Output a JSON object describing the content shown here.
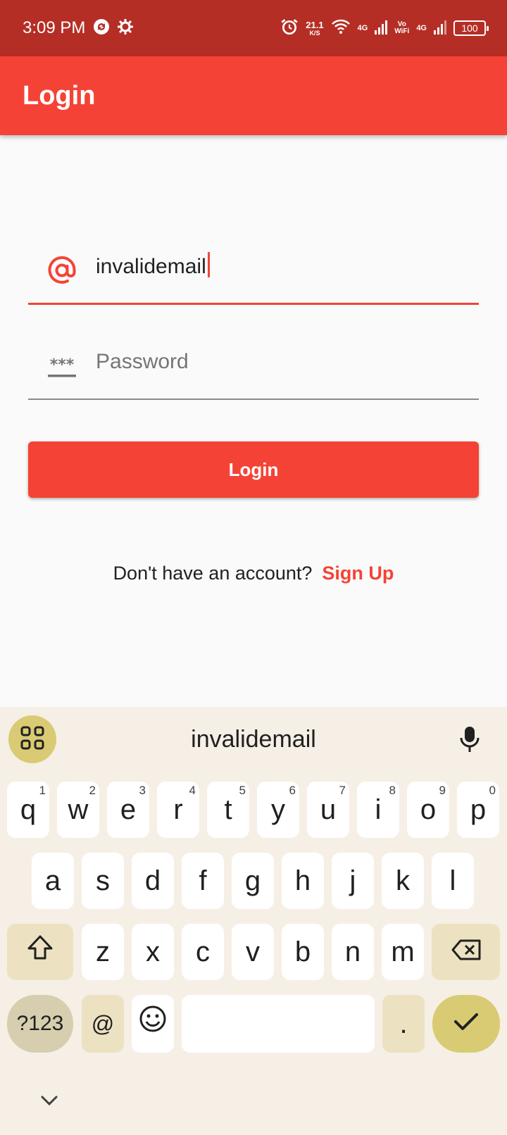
{
  "status_bar": {
    "time": "3:09 PM",
    "net_speed": "21.1",
    "net_speed_unit": "K/S",
    "sim1_tag": "4G",
    "vowifi_line1": "Vo",
    "vowifi_line2": "WiFi",
    "sim2_tag": "4G",
    "battery": "100"
  },
  "app_bar": {
    "title": "Login"
  },
  "form": {
    "email_value": "invalidemail",
    "password_placeholder": "Password",
    "login_label": "Login"
  },
  "signup": {
    "prompt": "Don't have an account?",
    "link": "Sign Up"
  },
  "keyboard": {
    "suggestion": "invalidemail",
    "row1": [
      {
        "label": "q",
        "hint": "1"
      },
      {
        "label": "w",
        "hint": "2"
      },
      {
        "label": "e",
        "hint": "3"
      },
      {
        "label": "r",
        "hint": "4"
      },
      {
        "label": "t",
        "hint": "5"
      },
      {
        "label": "y",
        "hint": "6"
      },
      {
        "label": "u",
        "hint": "7"
      },
      {
        "label": "i",
        "hint": "8"
      },
      {
        "label": "o",
        "hint": "9"
      },
      {
        "label": "p",
        "hint": "0"
      }
    ],
    "row2": [
      "a",
      "s",
      "d",
      "f",
      "g",
      "h",
      "j",
      "k",
      "l"
    ],
    "row3": [
      "z",
      "x",
      "c",
      "v",
      "b",
      "n",
      "m"
    ],
    "symbols_label": "?123",
    "at_label": "@",
    "period_label": "."
  },
  "colors": {
    "primary": "#f44336",
    "status_bar": "#b52e25",
    "keyboard_bg": "#f6efe6",
    "accent_key": "#d8cb73"
  }
}
